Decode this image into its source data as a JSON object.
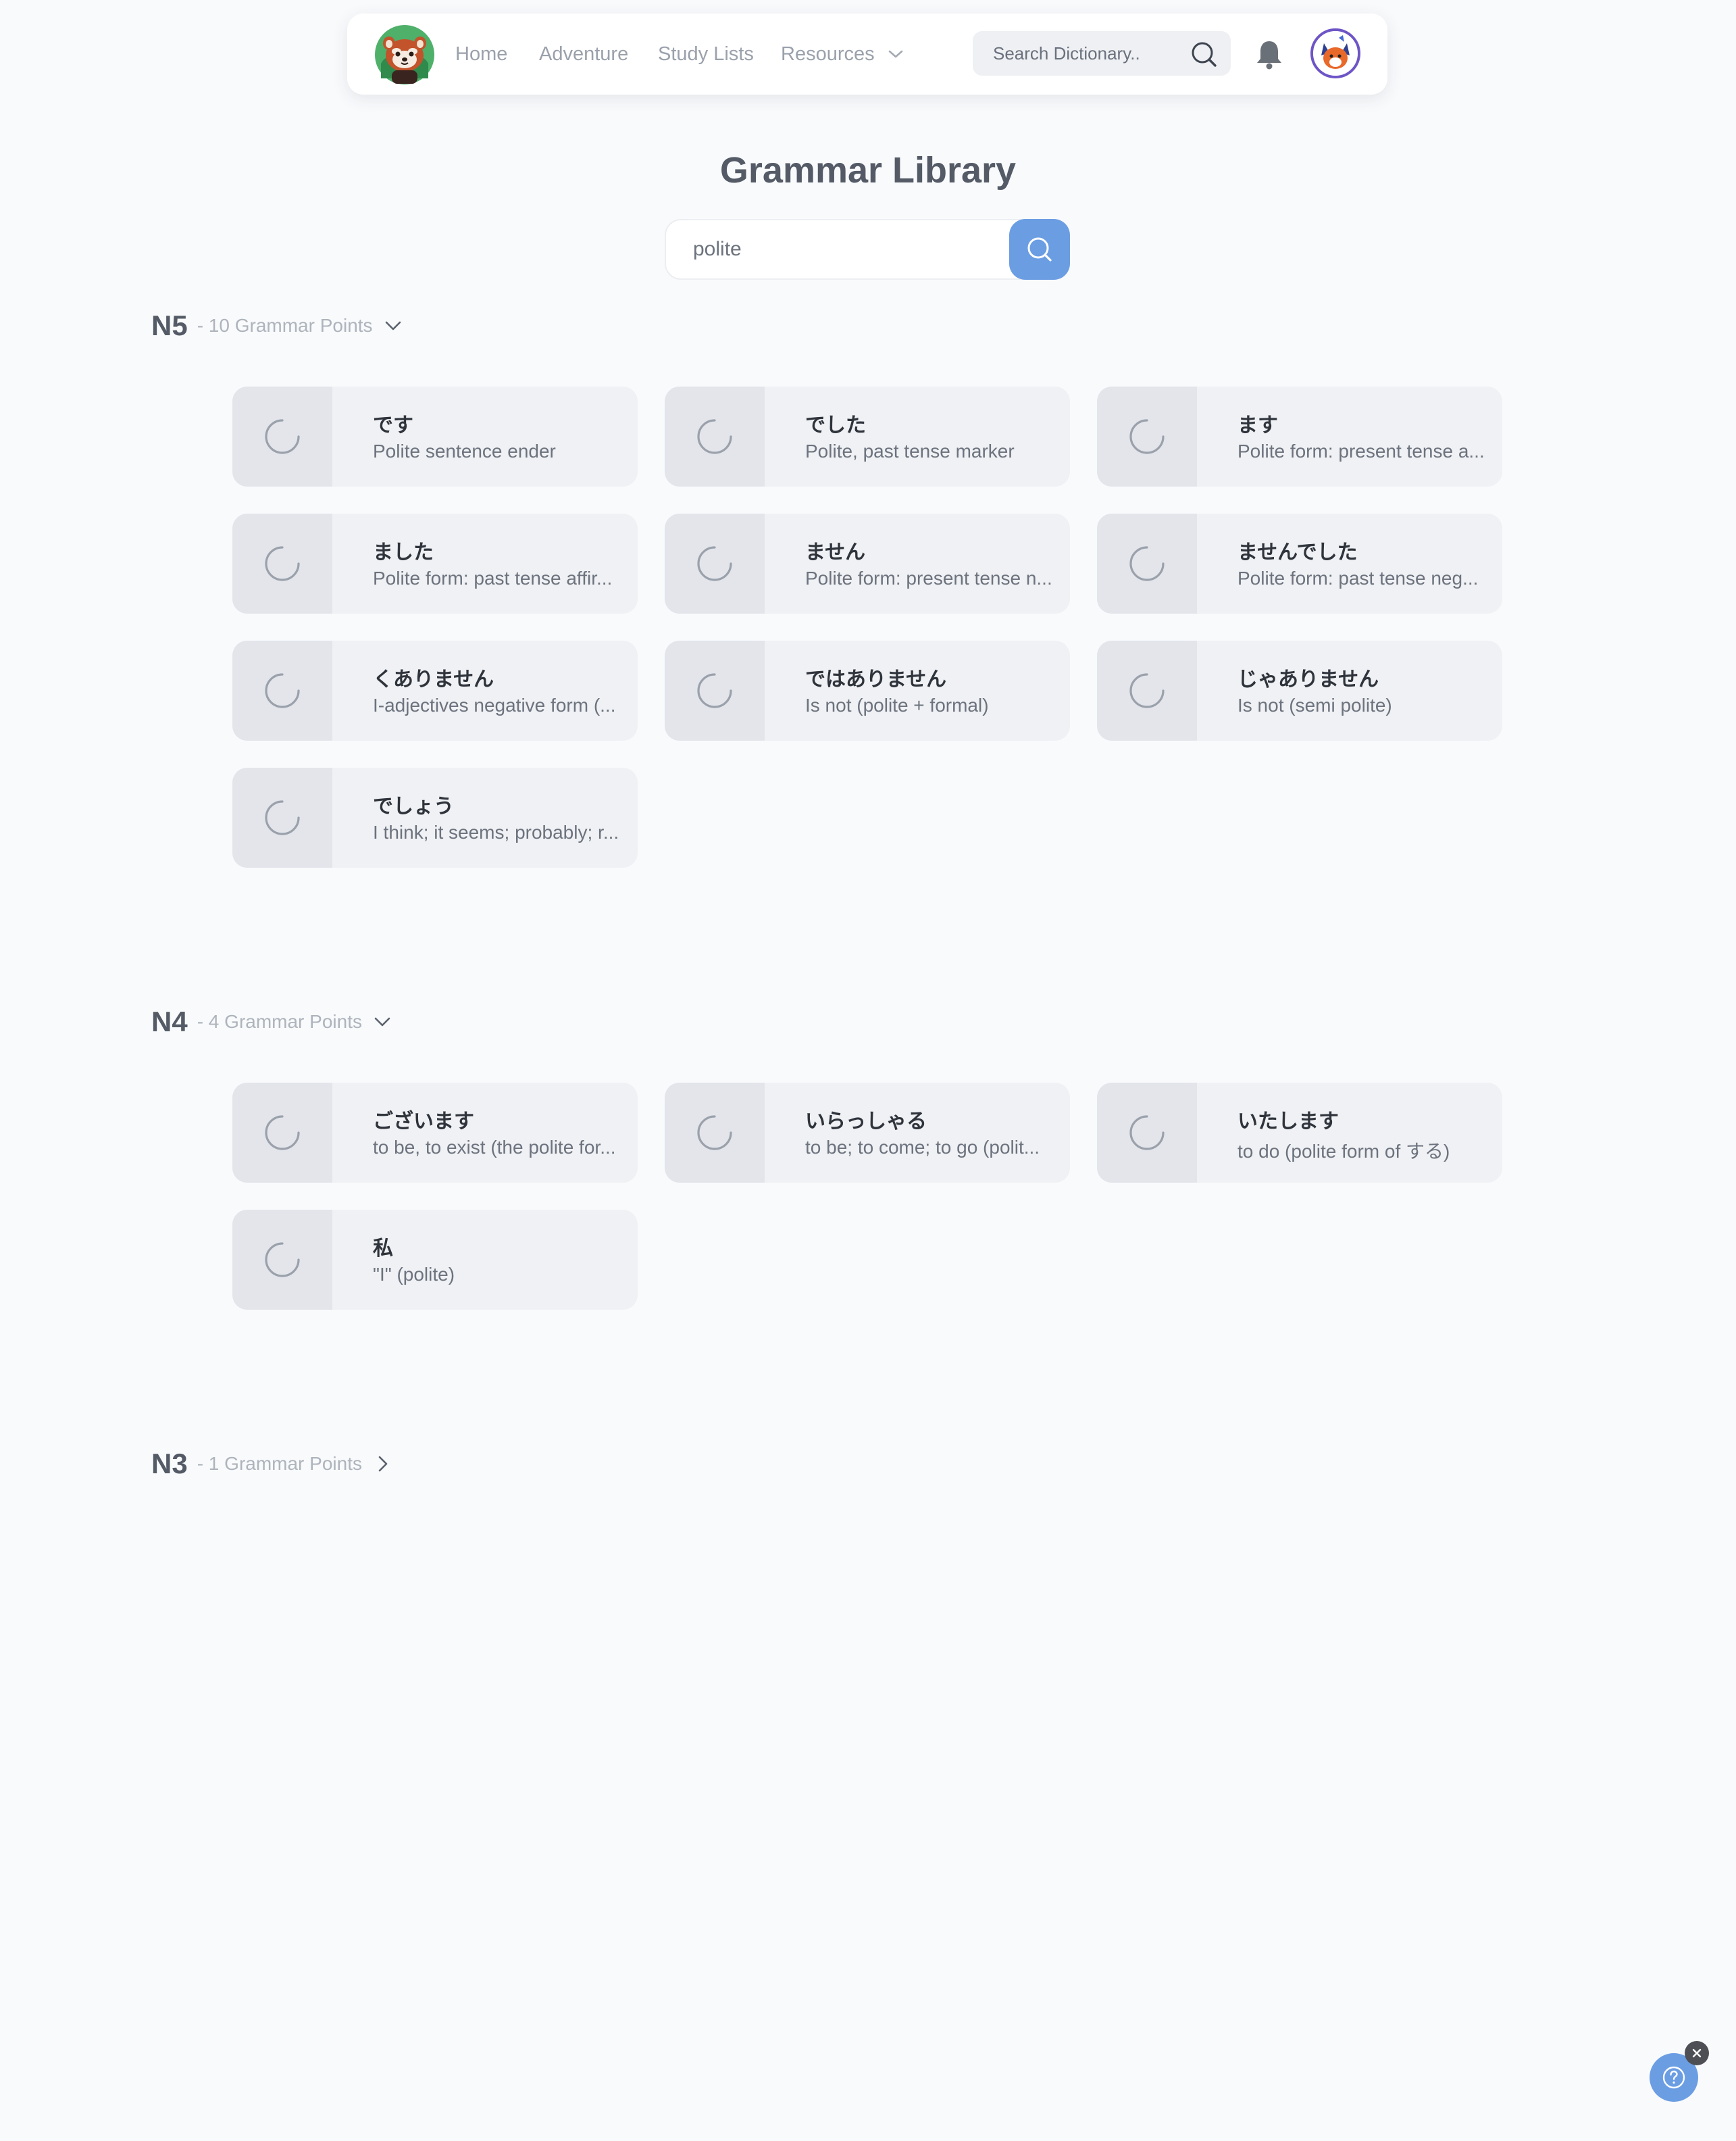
{
  "nav": {
    "links": [
      "Home",
      "Adventure",
      "Study Lists",
      "Resources"
    ],
    "dictionary_placeholder": "Search Dictionary.."
  },
  "page": {
    "title": "Grammar Library",
    "search_value": "polite"
  },
  "levels": [
    {
      "name": "N5",
      "count": "- 10 Grammar Points",
      "expanded": true,
      "items": [
        {
          "title": "です",
          "desc": "Polite sentence ender"
        },
        {
          "title": "でした",
          "desc": "Polite, past tense marker"
        },
        {
          "title": "ます",
          "desc": "Polite form: present tense a..."
        },
        {
          "title": "ました",
          "desc": "Polite form: past tense affir..."
        },
        {
          "title": "ません",
          "desc": "Polite form: present tense n..."
        },
        {
          "title": "ませんでした",
          "desc": "Polite form: past tense neg..."
        },
        {
          "title": "くありません",
          "desc": "I-adjectives negative form (..."
        },
        {
          "title": "ではありません",
          "desc": "Is not (polite + formal)"
        },
        {
          "title": "じゃありません",
          "desc": "Is not (semi polite)"
        },
        {
          "title": "でしょう",
          "desc": "I think; it seems; probably; r..."
        }
      ]
    },
    {
      "name": "N4",
      "count": "- 4 Grammar Points",
      "expanded": true,
      "items": [
        {
          "title": "ございます",
          "desc": "to be, to exist (the polite for..."
        },
        {
          "title": "いらっしゃる",
          "desc": "to be; to come; to go (polit..."
        },
        {
          "title": "いたします",
          "desc": "to do (polite form of する)"
        },
        {
          "title": "私",
          "desc": "\"I\" (polite)"
        }
      ]
    },
    {
      "name": "N3",
      "count": "- 1 Grammar Points",
      "expanded": false,
      "items": []
    }
  ],
  "colors": {
    "accent": "#6b9de3",
    "card_bg": "#f0f1f4",
    "thumb_bg": "#e3e5eb",
    "avatar_ring": "#6e55c6"
  },
  "icons": {
    "logo": "red-panda-logo-icon",
    "dictionary_search": "search-icon",
    "notifications": "bell-icon",
    "avatar": "fox-avatar-icon",
    "grammar_search": "search-icon",
    "card_loading": "spinner-icon",
    "help": "question-icon",
    "help_close": "close-icon"
  }
}
